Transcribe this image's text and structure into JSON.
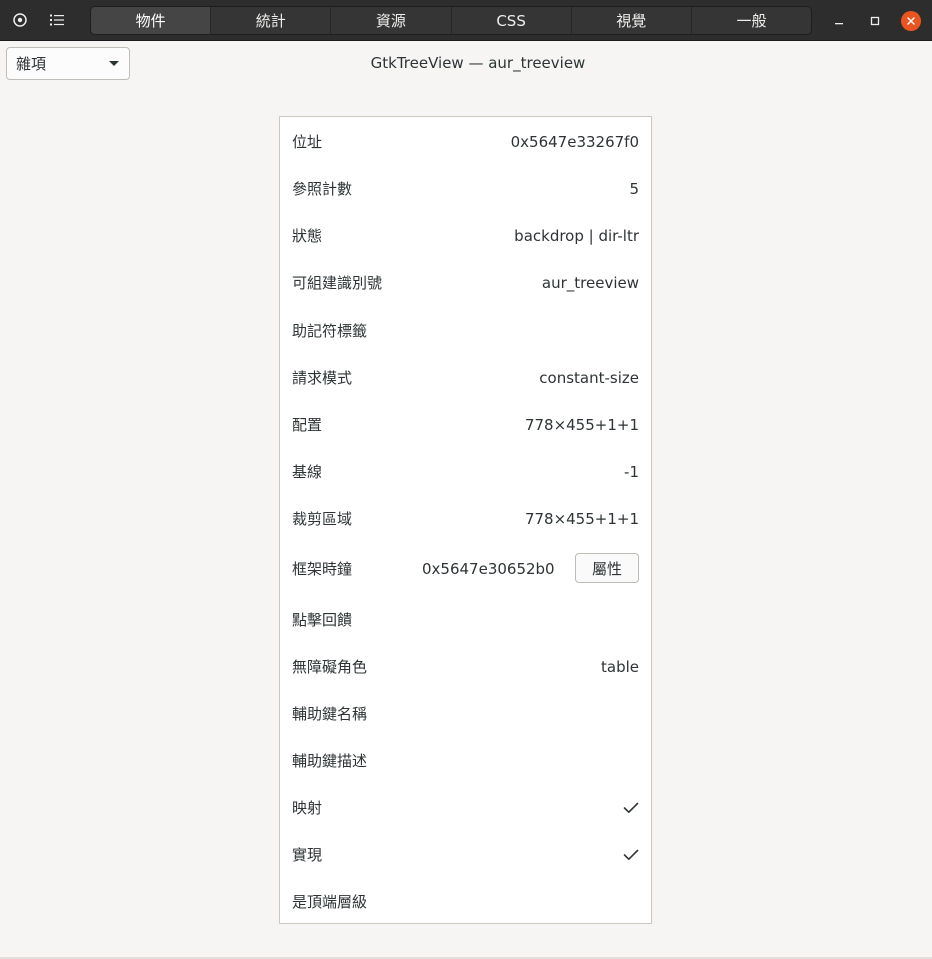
{
  "header": {
    "tabs": [
      {
        "label": "物件",
        "active": true
      },
      {
        "label": "統計",
        "active": false
      },
      {
        "label": "資源",
        "active": false
      },
      {
        "label": "CSS",
        "active": false
      },
      {
        "label": "視覺",
        "active": false
      },
      {
        "label": "一般",
        "active": false
      }
    ],
    "icons": {
      "select": "crosshair-icon",
      "objects": "list-icon",
      "minimize": "minimize-icon",
      "maximize": "maximize-icon",
      "close": "close-icon"
    },
    "accent_color": "#e95420"
  },
  "toolbar": {
    "combo_value": "雜項",
    "object_title": "GtkTreeView — aur_treeview"
  },
  "properties": [
    {
      "label": "位址",
      "value": "0x5647e33267f0"
    },
    {
      "label": "參照計數",
      "value": "5"
    },
    {
      "label": "狀態",
      "value": "backdrop | dir-ltr"
    },
    {
      "label": "可組建識別號",
      "value": "aur_treeview"
    },
    {
      "label": "助記符標籤",
      "value": ""
    },
    {
      "label": "請求模式",
      "value": "constant-size"
    },
    {
      "label": "配置",
      "value": "778×455+1+1"
    },
    {
      "label": "基線",
      "value": "-1"
    },
    {
      "label": "裁剪區域",
      "value": "778×455+1+1"
    },
    {
      "label": "框架時鐘",
      "value": "0x5647e30652b0",
      "button": "屬性"
    },
    {
      "label": "點擊回饋",
      "value": ""
    },
    {
      "label": "無障礙角色",
      "value": "table"
    },
    {
      "label": "輔助鍵名稱",
      "value": ""
    },
    {
      "label": "輔助鍵描述",
      "value": ""
    },
    {
      "label": "映射",
      "checked": true
    },
    {
      "label": "實現",
      "checked": true
    },
    {
      "label": "是頂端層級",
      "value": ""
    }
  ]
}
